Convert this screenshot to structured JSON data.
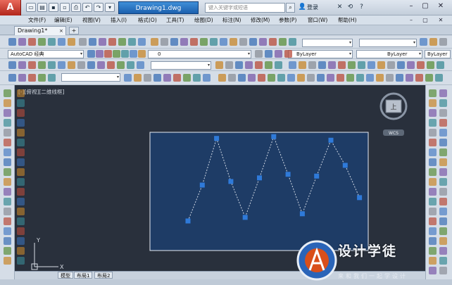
{
  "app": {
    "logo_letter": "A",
    "file_title": "Drawing1.dwg",
    "search_placeholder": "键入关键字或短语",
    "login_label": "登录"
  },
  "menu": [
    "文件(F)",
    "编辑(E)",
    "视图(V)",
    "插入(I)",
    "格式(O)",
    "工具(T)",
    "绘图(D)",
    "标注(N)",
    "修改(M)",
    "参数(P)",
    "窗口(W)",
    "帮助(H)"
  ],
  "doc_tab": {
    "label": "Drawing1*",
    "close": "×",
    "new": "+"
  },
  "toolbar": {
    "workspace": "AutoCAD 经典",
    "layer": "0",
    "color": "ByLayer",
    "linetype": "ByLayer",
    "lineweight": "ByLayer"
  },
  "viewport_label": "[-][俯视][二维线框]",
  "viewcube": {
    "face": "上",
    "badge": "WCS"
  },
  "ucs": {
    "y": "Y",
    "x": "X"
  },
  "layout_tabs": [
    "模型",
    "布局1",
    "布局2"
  ],
  "watermark": {
    "title": "设计学徒",
    "subtitle": "来和我们一起学设计"
  },
  "colors": {
    "canvas": "#29303c",
    "selection": "#1e3c66",
    "grip": "#2f7ad9",
    "polyline": "#d0d8e4"
  },
  "polyline_points": [
    [
      0,
      0
    ],
    [
      1,
      2
    ],
    [
      2,
      4.6
    ],
    [
      3,
      2.2
    ],
    [
      4,
      0.2
    ],
    [
      5,
      2.4
    ],
    [
      6,
      4.7
    ],
    [
      7,
      2.6
    ],
    [
      8,
      0.4
    ],
    [
      9,
      2.5
    ],
    [
      10,
      4.5
    ],
    [
      11,
      3.1
    ],
    [
      12,
      1.3
    ]
  ]
}
